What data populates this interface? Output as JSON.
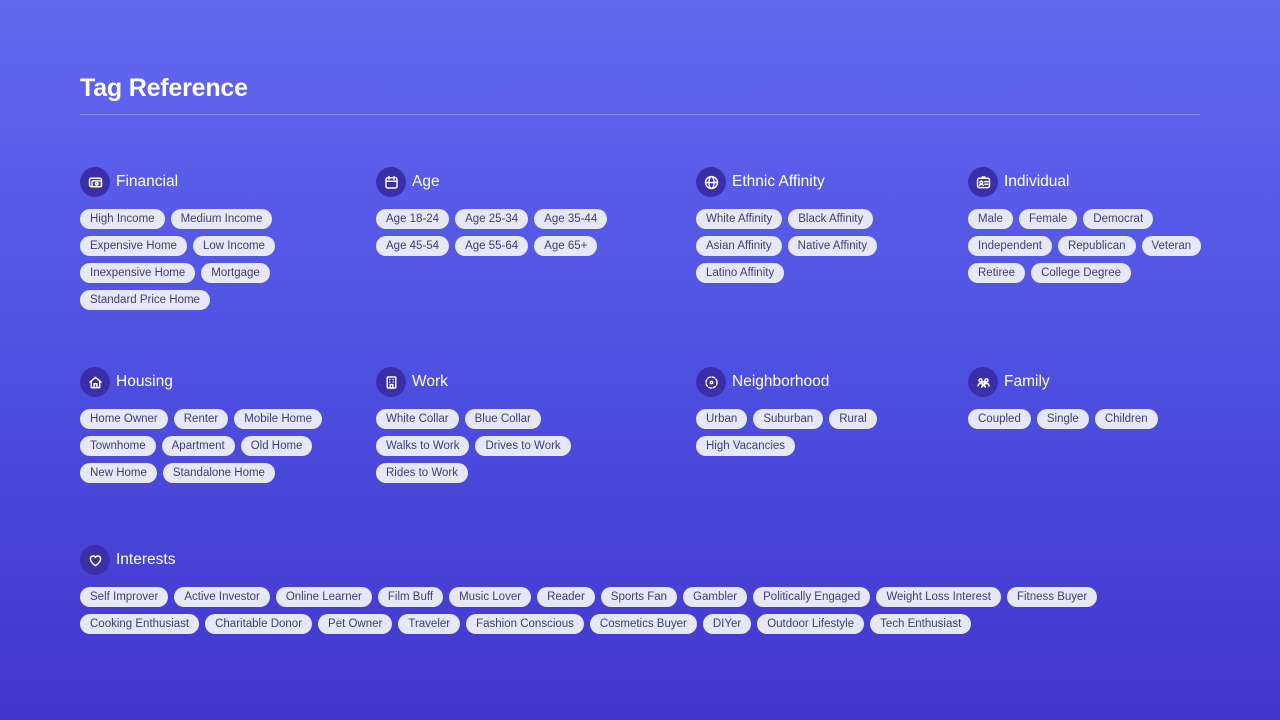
{
  "page": {
    "title": "Tag Reference"
  },
  "sections": {
    "financial": {
      "title": "Financial",
      "icon": "money-icon",
      "tags": [
        "High Income",
        "Medium Income",
        "Expensive Home",
        "Low Income",
        "Inexpensive Home",
        "Mortgage",
        "Standard Price Home"
      ]
    },
    "age": {
      "title": "Age",
      "icon": "calendar-icon",
      "tags": [
        "Age 18-24",
        "Age 25-34",
        "Age 35-44",
        "Age 45-54",
        "Age 55-64",
        "Age 65+"
      ]
    },
    "ethnic": {
      "title": "Ethnic Affinity",
      "icon": "globe-icon",
      "tags": [
        "White Affinity",
        "Black Affinity",
        "Asian Affinity",
        "Native Affinity",
        "Latino Affinity"
      ]
    },
    "individual": {
      "title": "Individual",
      "icon": "id-card-icon",
      "tags": [
        "Male",
        "Female",
        "Democrat",
        "Independent",
        "Republican",
        "Veteran",
        "Retiree",
        "College Degree"
      ]
    },
    "housing": {
      "title": "Housing",
      "icon": "home-icon",
      "tags": [
        "Home Owner",
        "Renter",
        "Mobile Home",
        "Townhome",
        "Apartment",
        "Old Home",
        "New Home",
        "Standalone Home"
      ]
    },
    "work": {
      "title": "Work",
      "icon": "building-icon",
      "tags": [
        "White Collar",
        "Blue Collar",
        "Walks to Work",
        "Drives to Work",
        "Rides to Work"
      ]
    },
    "neighborhood": {
      "title": "Neighborhood",
      "icon": "neighborhood-icon",
      "tags": [
        "Urban",
        "Suburban",
        "Rural",
        "High Vacancies"
      ]
    },
    "family": {
      "title": "Family",
      "icon": "family-icon",
      "tags": [
        "Coupled",
        "Single",
        "Children"
      ]
    },
    "interests": {
      "title": "Interests",
      "icon": "heart-icon",
      "tags": [
        "Self Improver",
        "Active Investor",
        "Online Learner",
        "Film Buff",
        "Music Lover",
        "Reader",
        "Sports Fan",
        "Gambler",
        "Politically Engaged",
        "Weight Loss Interest",
        "Fitness Buyer",
        "Cooking Enthusiast",
        "Charitable Donor",
        "Pet Owner",
        "Traveler",
        "Fashion Conscious",
        "Cosmetics Buyer",
        "DIYer",
        "Outdoor Lifestyle",
        "Tech Enthusiast"
      ]
    }
  }
}
